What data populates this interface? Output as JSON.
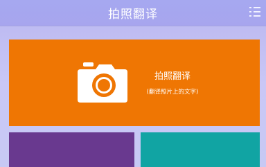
{
  "header": {
    "title": "拍照翻译",
    "menu_icon": "menu-list-icon"
  },
  "tiles": {
    "photo": {
      "label": "拍照翻译",
      "sublabel": "(翻译照片上的文字)",
      "icon": "camera-icon",
      "color": "#ef7603"
    },
    "purple": {
      "color": "#69398f"
    },
    "teal": {
      "color": "#11a4a3"
    }
  }
}
